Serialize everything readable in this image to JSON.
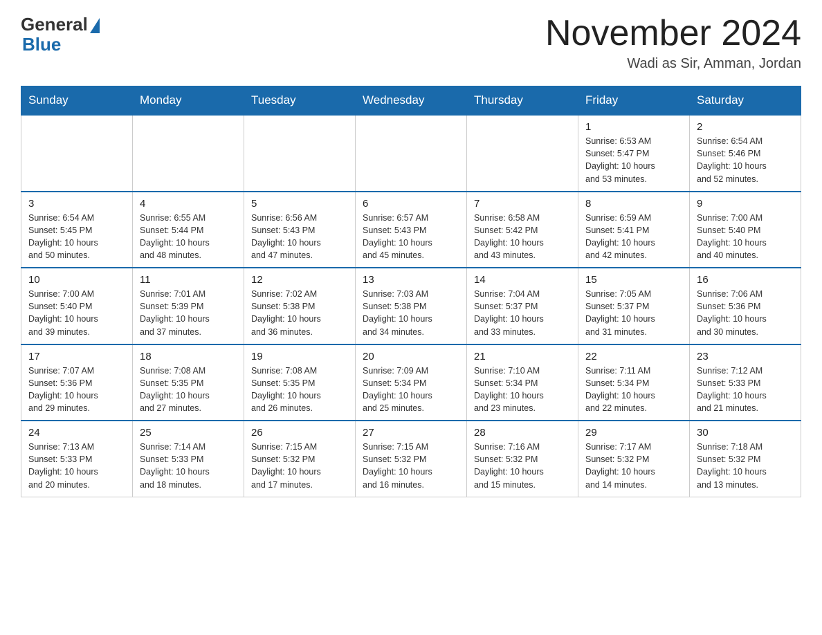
{
  "logo": {
    "general": "General",
    "blue": "Blue"
  },
  "title": "November 2024",
  "location": "Wadi as Sir, Amman, Jordan",
  "days_of_week": [
    "Sunday",
    "Monday",
    "Tuesday",
    "Wednesday",
    "Thursday",
    "Friday",
    "Saturday"
  ],
  "weeks": [
    {
      "days": [
        {
          "num": "",
          "info": ""
        },
        {
          "num": "",
          "info": ""
        },
        {
          "num": "",
          "info": ""
        },
        {
          "num": "",
          "info": ""
        },
        {
          "num": "",
          "info": ""
        },
        {
          "num": "1",
          "info": "Sunrise: 6:53 AM\nSunset: 5:47 PM\nDaylight: 10 hours\nand 53 minutes."
        },
        {
          "num": "2",
          "info": "Sunrise: 6:54 AM\nSunset: 5:46 PM\nDaylight: 10 hours\nand 52 minutes."
        }
      ]
    },
    {
      "days": [
        {
          "num": "3",
          "info": "Sunrise: 6:54 AM\nSunset: 5:45 PM\nDaylight: 10 hours\nand 50 minutes."
        },
        {
          "num": "4",
          "info": "Sunrise: 6:55 AM\nSunset: 5:44 PM\nDaylight: 10 hours\nand 48 minutes."
        },
        {
          "num": "5",
          "info": "Sunrise: 6:56 AM\nSunset: 5:43 PM\nDaylight: 10 hours\nand 47 minutes."
        },
        {
          "num": "6",
          "info": "Sunrise: 6:57 AM\nSunset: 5:43 PM\nDaylight: 10 hours\nand 45 minutes."
        },
        {
          "num": "7",
          "info": "Sunrise: 6:58 AM\nSunset: 5:42 PM\nDaylight: 10 hours\nand 43 minutes."
        },
        {
          "num": "8",
          "info": "Sunrise: 6:59 AM\nSunset: 5:41 PM\nDaylight: 10 hours\nand 42 minutes."
        },
        {
          "num": "9",
          "info": "Sunrise: 7:00 AM\nSunset: 5:40 PM\nDaylight: 10 hours\nand 40 minutes."
        }
      ]
    },
    {
      "days": [
        {
          "num": "10",
          "info": "Sunrise: 7:00 AM\nSunset: 5:40 PM\nDaylight: 10 hours\nand 39 minutes."
        },
        {
          "num": "11",
          "info": "Sunrise: 7:01 AM\nSunset: 5:39 PM\nDaylight: 10 hours\nand 37 minutes."
        },
        {
          "num": "12",
          "info": "Sunrise: 7:02 AM\nSunset: 5:38 PM\nDaylight: 10 hours\nand 36 minutes."
        },
        {
          "num": "13",
          "info": "Sunrise: 7:03 AM\nSunset: 5:38 PM\nDaylight: 10 hours\nand 34 minutes."
        },
        {
          "num": "14",
          "info": "Sunrise: 7:04 AM\nSunset: 5:37 PM\nDaylight: 10 hours\nand 33 minutes."
        },
        {
          "num": "15",
          "info": "Sunrise: 7:05 AM\nSunset: 5:37 PM\nDaylight: 10 hours\nand 31 minutes."
        },
        {
          "num": "16",
          "info": "Sunrise: 7:06 AM\nSunset: 5:36 PM\nDaylight: 10 hours\nand 30 minutes."
        }
      ]
    },
    {
      "days": [
        {
          "num": "17",
          "info": "Sunrise: 7:07 AM\nSunset: 5:36 PM\nDaylight: 10 hours\nand 29 minutes."
        },
        {
          "num": "18",
          "info": "Sunrise: 7:08 AM\nSunset: 5:35 PM\nDaylight: 10 hours\nand 27 minutes."
        },
        {
          "num": "19",
          "info": "Sunrise: 7:08 AM\nSunset: 5:35 PM\nDaylight: 10 hours\nand 26 minutes."
        },
        {
          "num": "20",
          "info": "Sunrise: 7:09 AM\nSunset: 5:34 PM\nDaylight: 10 hours\nand 25 minutes."
        },
        {
          "num": "21",
          "info": "Sunrise: 7:10 AM\nSunset: 5:34 PM\nDaylight: 10 hours\nand 23 minutes."
        },
        {
          "num": "22",
          "info": "Sunrise: 7:11 AM\nSunset: 5:34 PM\nDaylight: 10 hours\nand 22 minutes."
        },
        {
          "num": "23",
          "info": "Sunrise: 7:12 AM\nSunset: 5:33 PM\nDaylight: 10 hours\nand 21 minutes."
        }
      ]
    },
    {
      "days": [
        {
          "num": "24",
          "info": "Sunrise: 7:13 AM\nSunset: 5:33 PM\nDaylight: 10 hours\nand 20 minutes."
        },
        {
          "num": "25",
          "info": "Sunrise: 7:14 AM\nSunset: 5:33 PM\nDaylight: 10 hours\nand 18 minutes."
        },
        {
          "num": "26",
          "info": "Sunrise: 7:15 AM\nSunset: 5:32 PM\nDaylight: 10 hours\nand 17 minutes."
        },
        {
          "num": "27",
          "info": "Sunrise: 7:15 AM\nSunset: 5:32 PM\nDaylight: 10 hours\nand 16 minutes."
        },
        {
          "num": "28",
          "info": "Sunrise: 7:16 AM\nSunset: 5:32 PM\nDaylight: 10 hours\nand 15 minutes."
        },
        {
          "num": "29",
          "info": "Sunrise: 7:17 AM\nSunset: 5:32 PM\nDaylight: 10 hours\nand 14 minutes."
        },
        {
          "num": "30",
          "info": "Sunrise: 7:18 AM\nSunset: 5:32 PM\nDaylight: 10 hours\nand 13 minutes."
        }
      ]
    }
  ]
}
